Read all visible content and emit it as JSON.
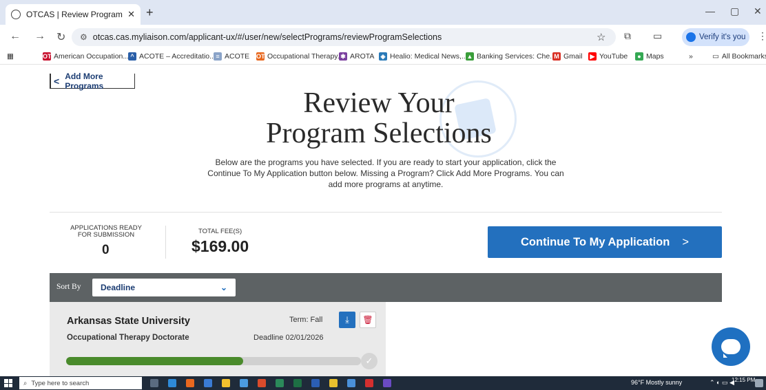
{
  "browser": {
    "tab_title": "OTCAS | Review Program Section",
    "tab_close": "✕",
    "new_tab": "+",
    "url": "otcas.cas.myliaison.com/applicant-ux/#/user/new/selectPrograms/reviewProgramSelections",
    "verify_label": "Verify it's you",
    "bookmarks": [
      {
        "label": "American Occupation...",
        "icon_color": "#c8102e",
        "icon": "OT"
      },
      {
        "label": "ACOTE – Accreditatio...",
        "icon_color": "#2a5fa8",
        "icon": "🎓"
      },
      {
        "label": "ACOTE",
        "icon_color": "#8aa3c8",
        "icon": "≡"
      },
      {
        "label": "Occupational Therapy...",
        "icon_color": "#e8681f",
        "icon": "OT"
      },
      {
        "label": "AROTA",
        "icon_color": "#7a3f9e",
        "icon": "✱"
      },
      {
        "label": "Healio: Medical News,...",
        "icon_color": "#2a7ab8",
        "icon": "◈"
      },
      {
        "label": "Banking Services: Che...",
        "icon_color": "#3a9e3a",
        "icon": "▲"
      },
      {
        "label": "Gmail",
        "icon_color": "#d93025",
        "icon": "M"
      },
      {
        "label": "YouTube",
        "icon_color": "#ff0000",
        "icon": "▶"
      },
      {
        "label": "Maps",
        "icon_color": "#34a853",
        "icon": "●"
      }
    ],
    "overflow": "»",
    "all_bookmarks": "All Bookmarks"
  },
  "page": {
    "add_more_label": "Add More Programs",
    "title_line1": "Review Your",
    "title_line2": "Program Selections",
    "description": "Below are the programs you have selected. If you are ready to start your application, click the Continue To My Application button below. Missing a Program? Click Add More Programs. You can add more programs at anytime.",
    "apps_ready_label_1": "APPLICATIONS READY",
    "apps_ready_label_2": "FOR SUBMISSION",
    "apps_ready_value": "0",
    "total_fee_label": "TOTAL FEE(S)",
    "total_fee_value": "$169.00",
    "continue_label": "Continue To My Application",
    "continue_arrow": ">",
    "sort_by_label": "Sort By",
    "sort_selected": "Deadline",
    "program": {
      "university": "Arkansas State University",
      "program_name": "Occupational Therapy Doctorate",
      "term": "Term: Fall",
      "deadline": "Deadline 02/01/2026",
      "progress": 0.6
    }
  },
  "taskbar": {
    "search_placeholder": "Type here to search",
    "weather": "96°F  Mostly sunny",
    "time": "12:15 PM"
  },
  "colors": {
    "accent": "#2370be",
    "progress": "#4a8b2c",
    "delete": "#c8102e"
  }
}
